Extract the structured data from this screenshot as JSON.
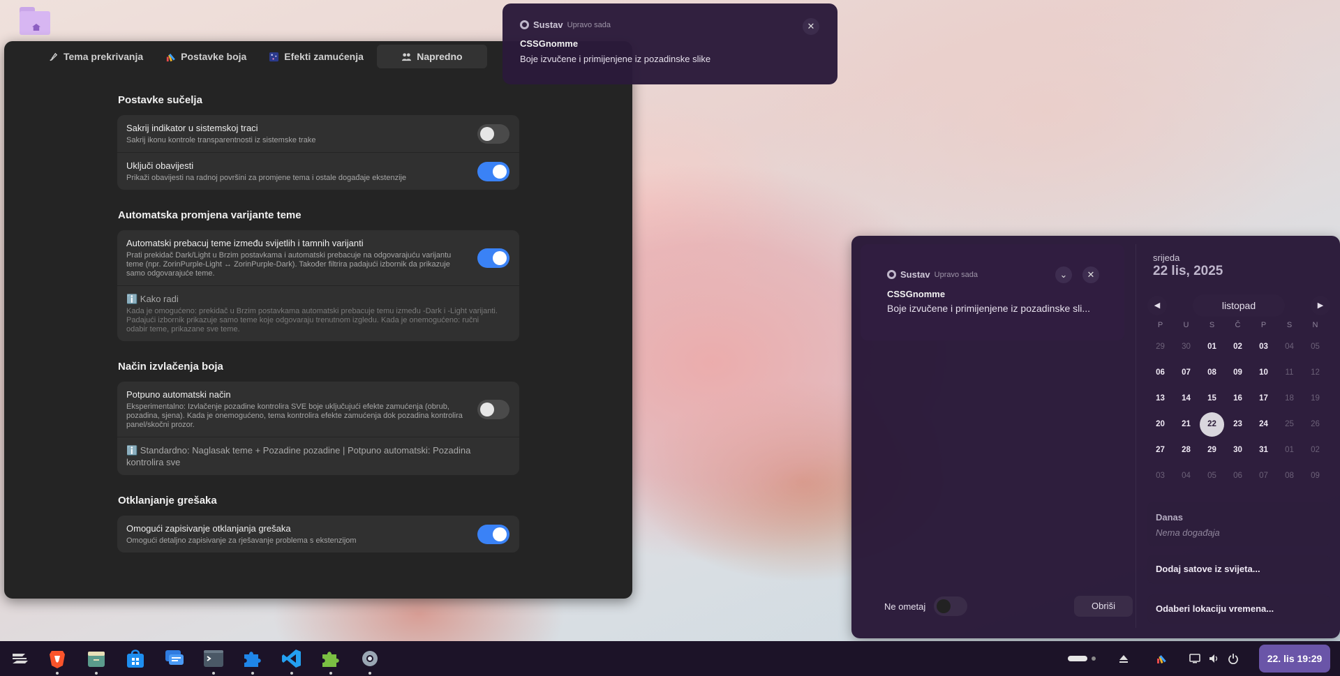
{
  "settings": {
    "tabs": [
      {
        "label": "Tema prekrivanja",
        "icon": "brush-icon"
      },
      {
        "label": "Postavke boja",
        "icon": "palette-icon"
      },
      {
        "label": "Efekti zamućenja",
        "icon": "blur-icon"
      },
      {
        "label": "Napredno",
        "icon": "people-icon"
      }
    ],
    "sections": [
      {
        "title": "Postavke sučelja",
        "rows": [
          {
            "title": "Sakrij indikator u sistemskoj traci",
            "subtitle": "Sakrij ikonu kontrole transparentnosti iz sistemske trake",
            "toggle": false
          },
          {
            "title": "Uključi obavijesti",
            "subtitle": "Prikaži obavijesti na radnoj površini za promjene tema i ostale događaje ekstenzije",
            "toggle": true
          }
        ]
      },
      {
        "title": "Automatska promjena varijante teme",
        "rows": [
          {
            "title": "Automatski prebacuj teme između svijetlih i tamnih varijanti",
            "subtitle": "Prati prekidač Dark/Light u Brzim postavkama i automatski prebacuje na odgovarajuću varijantu teme (npr. ZorinPurple-Light ↔ ZorinPurple-Dark). Također filtrira padajući izbornik da prikazuje samo odgovarajuće teme.",
            "toggle": true
          },
          {
            "title": "ℹ️ Kako radi",
            "subtitle": "Kada je omogućeno: prekidač u Brzim postavkama automatski prebacuje temu između -Dark i -Light varijanti. Padajući izbornik prikazuje samo teme koje odgovaraju trenutnom izgledu. Kada je onemogućeno: ručni odabir teme, prikazane sve teme."
          }
        ]
      },
      {
        "title": "Način izvlačenja boja",
        "rows": [
          {
            "title": "Potpuno automatski način",
            "subtitle": "Eksperimentalno: Izvlačenje pozadine kontrolira SVE boje uključujući efekte zamućenja (obrub, pozadina, sjena). Kada je onemogućeno, tema kontrolira efekte zamućenja dok pozadina kontrolira panel/skočni prozor.",
            "toggle": false
          },
          {
            "title": "ℹ️ Standardno: Naglasak teme + Pozadine pozadine | Potpuno automatski: Pozadina kontrolira sve"
          }
        ]
      },
      {
        "title": "Otklanjanje grešaka",
        "rows": [
          {
            "title": "Omogući zapisivanje otklanjanja grešaka",
            "subtitle": "Omogući detaljno zapisivanje za rješavanje problema s ekstenzijom",
            "toggle": true
          }
        ]
      }
    ]
  },
  "banner": {
    "source": "Sustav",
    "time": "Upravo sada",
    "app": "CSSGnomme",
    "body": "Boje izvučene i primijenjene iz pozadinske slike",
    "close_glyph": "✕"
  },
  "panel": {
    "notification": {
      "source": "Sustav",
      "time": "Upravo sada",
      "app": "CSSGnomme",
      "body": "Boje izvučene i primijenjene iz pozadinske sli...",
      "expand_glyph": "⌄",
      "close_glyph": "✕"
    },
    "dnd_label": "Ne ometaj",
    "dnd_on": false,
    "clear_label": "Obriši",
    "calendar": {
      "weekday": "srijeda",
      "date": "22 lis, 2025",
      "month": "listopad",
      "prev_glyph": "◀",
      "next_glyph": "▶",
      "day_headers": [
        "P",
        "U",
        "S",
        "Č",
        "P",
        "S",
        "N"
      ],
      "weeks": [
        [
          "29",
          "30",
          "01",
          "02",
          "03",
          "04",
          "05"
        ],
        [
          "06",
          "07",
          "08",
          "09",
          "10",
          "11",
          "12"
        ],
        [
          "13",
          "14",
          "15",
          "16",
          "17",
          "18",
          "19"
        ],
        [
          "20",
          "21",
          "22",
          "23",
          "24",
          "25",
          "26"
        ],
        [
          "27",
          "28",
          "29",
          "30",
          "31",
          "01",
          "02"
        ],
        [
          "03",
          "04",
          "05",
          "06",
          "07",
          "08",
          "09"
        ]
      ],
      "today": "22"
    },
    "today_title": "Danas",
    "today_empty": "Nema događaja",
    "world_clocks": "Dodaj satove iz svijeta...",
    "weather": "Odaberi lokaciju vremena..."
  },
  "taskbar": {
    "apps": [
      {
        "name": "zorin-menu-icon"
      },
      {
        "name": "brave-browser-icon"
      },
      {
        "name": "files-icon"
      },
      {
        "name": "software-store-icon"
      },
      {
        "name": "chat-icon"
      },
      {
        "name": "terminal-icon"
      },
      {
        "name": "extensions-icon"
      },
      {
        "name": "vscode-icon"
      },
      {
        "name": "extension-manager-icon"
      },
      {
        "name": "settings-icon"
      }
    ],
    "clock": "22. lis  19:29"
  },
  "colors": {
    "accent": "#3a82f6",
    "panel_bg": "#26163a",
    "clock_bg": "#6a55a8"
  }
}
